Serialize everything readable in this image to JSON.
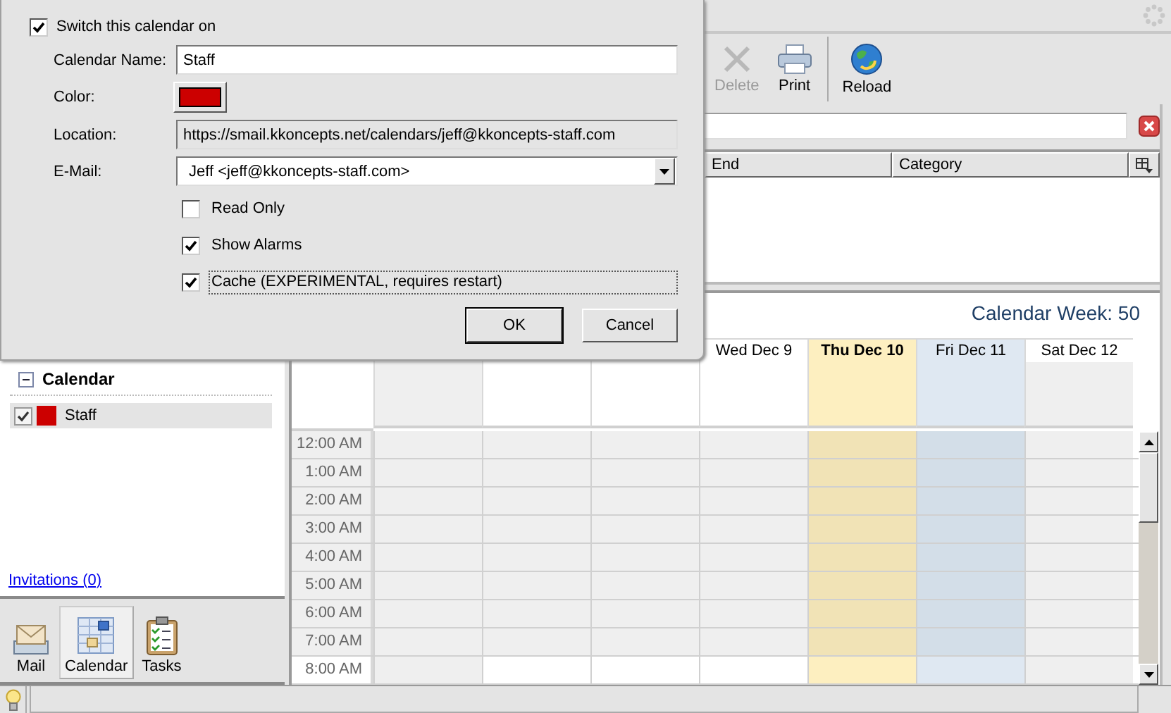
{
  "dialog": {
    "switch": {
      "label": "Switch this calendar on",
      "checked": true
    },
    "name": {
      "label": "Calendar Name:",
      "value": "Staff"
    },
    "color": {
      "label": "Color:",
      "color": "#cc0000"
    },
    "location": {
      "label": "Location:",
      "value": "https://smail.kkoncepts.net/calendars/jeff@kkoncepts-staff.com"
    },
    "email": {
      "label": "E-Mail:",
      "value": "Jeff <jeff@kkoncepts-staff.com>"
    },
    "options": [
      {
        "label": "Read Only",
        "checked": false,
        "focused": false
      },
      {
        "label": "Show Alarms",
        "checked": true,
        "focused": false
      },
      {
        "label": "Cache (EXPERIMENTAL, requires restart)",
        "checked": true,
        "focused": true
      }
    ],
    "buttons": [
      {
        "label": "OK",
        "kind": "default"
      },
      {
        "label": "Cancel",
        "kind": "normal"
      }
    ]
  },
  "toolbar": [
    {
      "label": "Delete",
      "kind": "delete",
      "disabled": true
    },
    {
      "label": "Print",
      "kind": "print",
      "disabled": false
    },
    {
      "label": "Reload",
      "kind": "reload",
      "disabled": false
    }
  ],
  "list": {
    "columns": [
      {
        "label": "End"
      },
      {
        "label": "Category"
      }
    ]
  },
  "calendar": {
    "week_label": "Calendar Week: 50",
    "days": [
      {
        "kind": "weekend"
      },
      {
        "kind": "workday"
      },
      {
        "kind": "workday"
      },
      {
        "label": "Wed Dec 9",
        "kind": "workday"
      },
      {
        "label": "Thu Dec 10",
        "kind": "today"
      },
      {
        "label": "Fri Dec 11",
        "kind": "selected"
      },
      {
        "label": "Sat Dec 12",
        "kind": "weekend"
      }
    ],
    "hours": [
      {
        "label": "12:00 AM",
        "working": false
      },
      {
        "label": "1:00 AM",
        "working": false
      },
      {
        "label": "2:00 AM",
        "working": false
      },
      {
        "label": "3:00 AM",
        "working": false
      },
      {
        "label": "4:00 AM",
        "working": false
      },
      {
        "label": "5:00 AM",
        "working": false
      },
      {
        "label": "6:00 AM",
        "working": false
      },
      {
        "label": "7:00 AM",
        "working": false
      },
      {
        "label": "8:00 AM",
        "working": true
      }
    ]
  },
  "sidebar": {
    "group": {
      "label": "Calendar",
      "expanded": true,
      "items": [
        {
          "label": "Staff",
          "checked": true,
          "selected": true,
          "color": "#cc0000"
        }
      ]
    },
    "invitations": "Invitations (0)"
  },
  "nav": [
    {
      "label": "Mail",
      "kind": "mail",
      "selected": false
    },
    {
      "label": "Calendar",
      "kind": "calendar",
      "selected": true
    },
    {
      "label": "Tasks",
      "kind": "tasks",
      "selected": false
    }
  ]
}
